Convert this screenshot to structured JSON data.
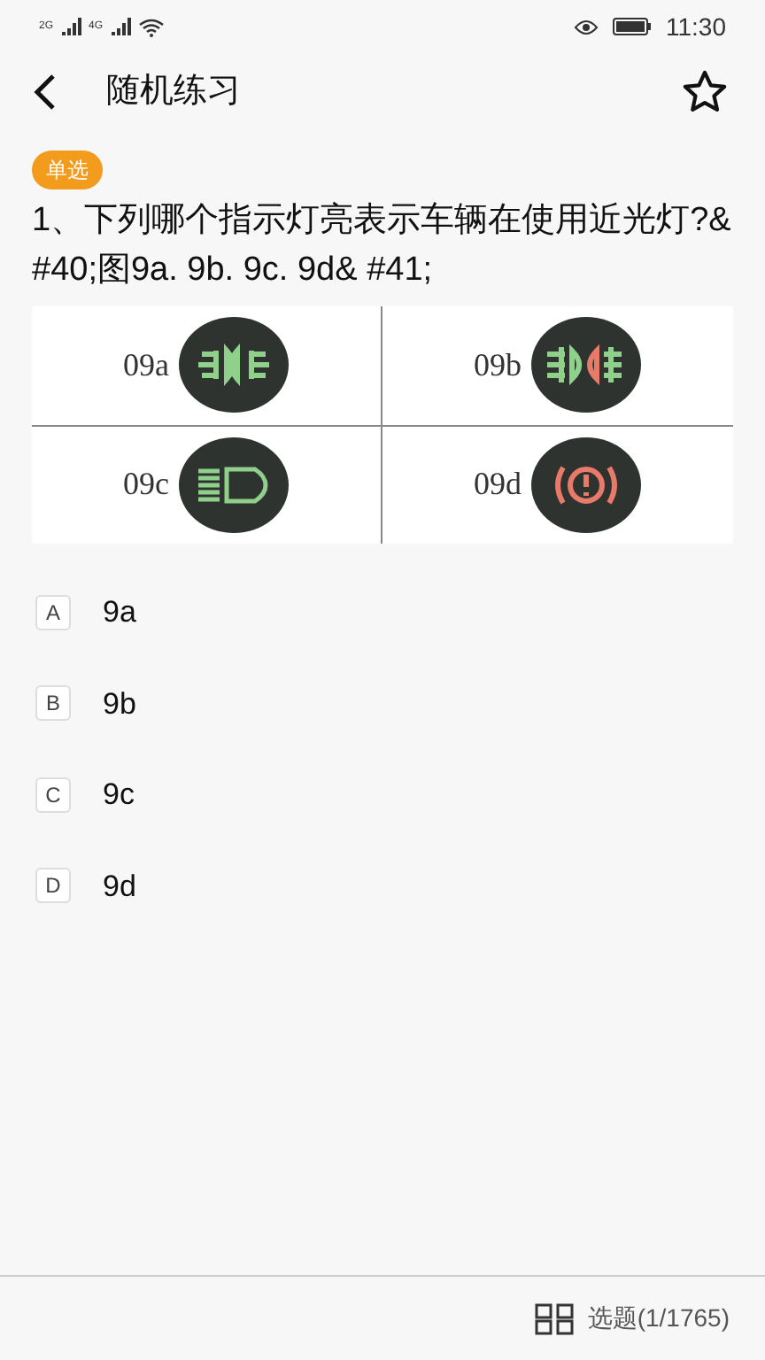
{
  "status_bar": {
    "time": "11:30",
    "network_1": "2G",
    "network_2": "4G"
  },
  "header": {
    "title": "随机练习"
  },
  "question": {
    "type_badge": "单选",
    "text": "1、下列哪个指示灯亮表示车辆在使用近光灯?& #40;图9a. 9b. 9c. 9d& #41;",
    "figure": [
      {
        "label": "09a",
        "kind": "a"
      },
      {
        "label": "09b",
        "kind": "b"
      },
      {
        "label": "09c",
        "kind": "c"
      },
      {
        "label": "09d",
        "kind": "d"
      }
    ]
  },
  "options": [
    {
      "letter": "A",
      "text": "9a",
      "selected": false
    },
    {
      "letter": "B",
      "text": "9b",
      "selected": false
    },
    {
      "letter": "C",
      "text": "9c",
      "selected": false
    },
    {
      "letter": "D",
      "text": "9d",
      "selected": false
    }
  ],
  "bottom_bar": {
    "counter": "选题(1/1765)"
  }
}
